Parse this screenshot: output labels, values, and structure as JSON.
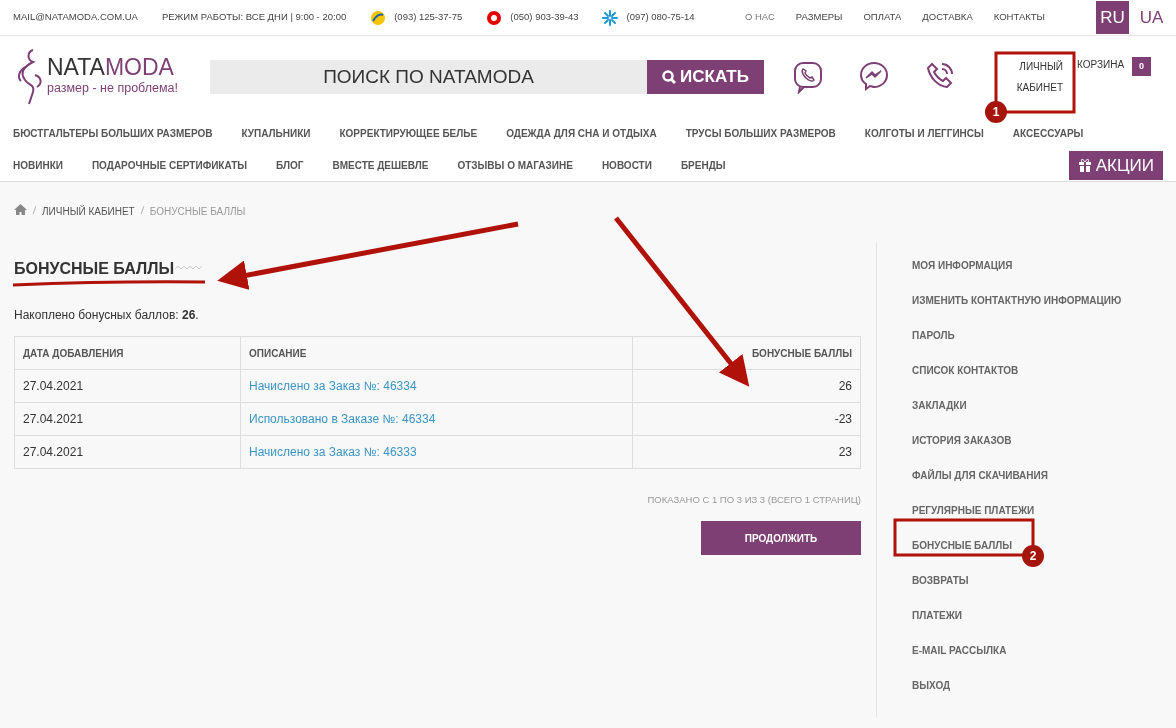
{
  "topbar": {
    "email": "MAIL@NATAMODA.COM.UA",
    "hours": "РЕЖИМ РАБОТЫ: ВСЕ ДНИ | 9:00 - 20:00",
    "phones": [
      {
        "kind": "life",
        "number": "(093) 125-37-75"
      },
      {
        "kind": "vodafone",
        "number": "(050) 903-39-43"
      },
      {
        "kind": "kyivstar",
        "number": "(097) 080-75-14"
      }
    ],
    "links": [
      "О НАС",
      "РАЗМЕРЫ",
      "ОПЛАТА",
      "ДОСТАВКА",
      "КОНТАКТЫ"
    ],
    "languages": [
      {
        "label": "RU",
        "selected": true
      },
      {
        "label": "UA",
        "selected": false
      }
    ]
  },
  "header": {
    "logo": {
      "part_1": "NATA",
      "part_2": "MODA",
      "tagline": "размер - не проблема!"
    },
    "search": {
      "placeholder": "ПОИСК ПО NATAMODA",
      "button": "ИСКАТЬ"
    },
    "account": {
      "line_1": "ЛИЧНЫЙ",
      "line_2": "КАБИНЕТ"
    },
    "cart": {
      "label": "КОРЗИНА",
      "count": "0"
    }
  },
  "menu": {
    "row_1": [
      "БЮСТГАЛЬТЕРЫ БОЛЬШИХ РАЗМЕРОВ",
      "КУПАЛЬНИКИ",
      "КОРРЕКТИРУЮЩЕЕ БЕЛЬЕ",
      "ОДЕЖДА ДЛЯ СНА И ОТДЫХА",
      "ТРУСЫ БОЛЬШИХ РАЗМЕРОВ",
      "КОЛГОТЫ И ЛЕГГИНСЫ",
      "АКСЕССУАРЫ"
    ],
    "row_2": [
      "НОВИНКИ",
      "ПОДАРОЧНЫЕ СЕРТИФИКАТЫ",
      "БЛОГ",
      "ВМЕСТЕ ДЕШЕВЛЕ",
      "ОТЗЫВЫ О МАГАЗИНЕ",
      "НОВОСТИ",
      "БРЕНДЫ"
    ],
    "promo": "АКЦИИ"
  },
  "breadcrumb": [
    "ЛИЧНЫЙ КАБИНЕТ",
    "БОНУСНЫЕ БАЛЛЫ"
  ],
  "page": {
    "title": "БОНУСНЫЕ БАЛЛЫ",
    "summary": "Накоплено бонусных баллов: **26**.",
    "table": {
      "columns": [
        "ДАТА ДОБАВЛЕНИЯ",
        "ОПИСАНИЕ",
        "БОНУСНЫЕ БАЛЛЫ"
      ],
      "rows": [
        [
          "27.04.2021",
          "Начислено за Заказ №: 46334",
          "26"
        ],
        [
          "27.04.2021",
          "Использовано в Заказе №: 46334",
          "-23"
        ],
        [
          "27.04.2021",
          "Начислено за Заказ №: 46333",
          "23"
        ]
      ]
    },
    "pagination": "ПОКАЗАНО С 1 ПО 3 ИЗ 3 (ВСЕГО 1 СТРАНИЦ)",
    "continue_button": "ПРОДОЛЖИТЬ"
  },
  "sidebar": {
    "items": [
      {
        "label": "МОЯ ИНФОРМАЦИЯ"
      },
      {
        "label": "ИЗМЕНИТЬ КОНТАКТНУЮ ИНФОРМАЦИЮ"
      },
      {
        "label": "ПАРОЛЬ"
      },
      {
        "label": "СПИСОК КОНТАКТОВ"
      },
      {
        "label": "ЗАКЛАДКИ"
      },
      {
        "label": "ИСТОРИЯ ЗАКАЗОВ"
      },
      {
        "label": "ФАЙЛЫ ДЛЯ СКАЧИВАНИЯ"
      },
      {
        "label": "РЕГУЛЯРНЫЕ ПЛАТЕЖИ"
      },
      {
        "label": "БОНУСНЫЕ БАЛЛЫ"
      },
      {
        "label": "ВОЗВРАТЫ"
      },
      {
        "label": "ПЛАТЕЖИ"
      },
      {
        "label": "E-MAIL РАССЫЛКА"
      },
      {
        "label": "ВЫХОД"
      }
    ]
  },
  "annotations": {
    "markers": [
      "1",
      "2"
    ]
  }
}
